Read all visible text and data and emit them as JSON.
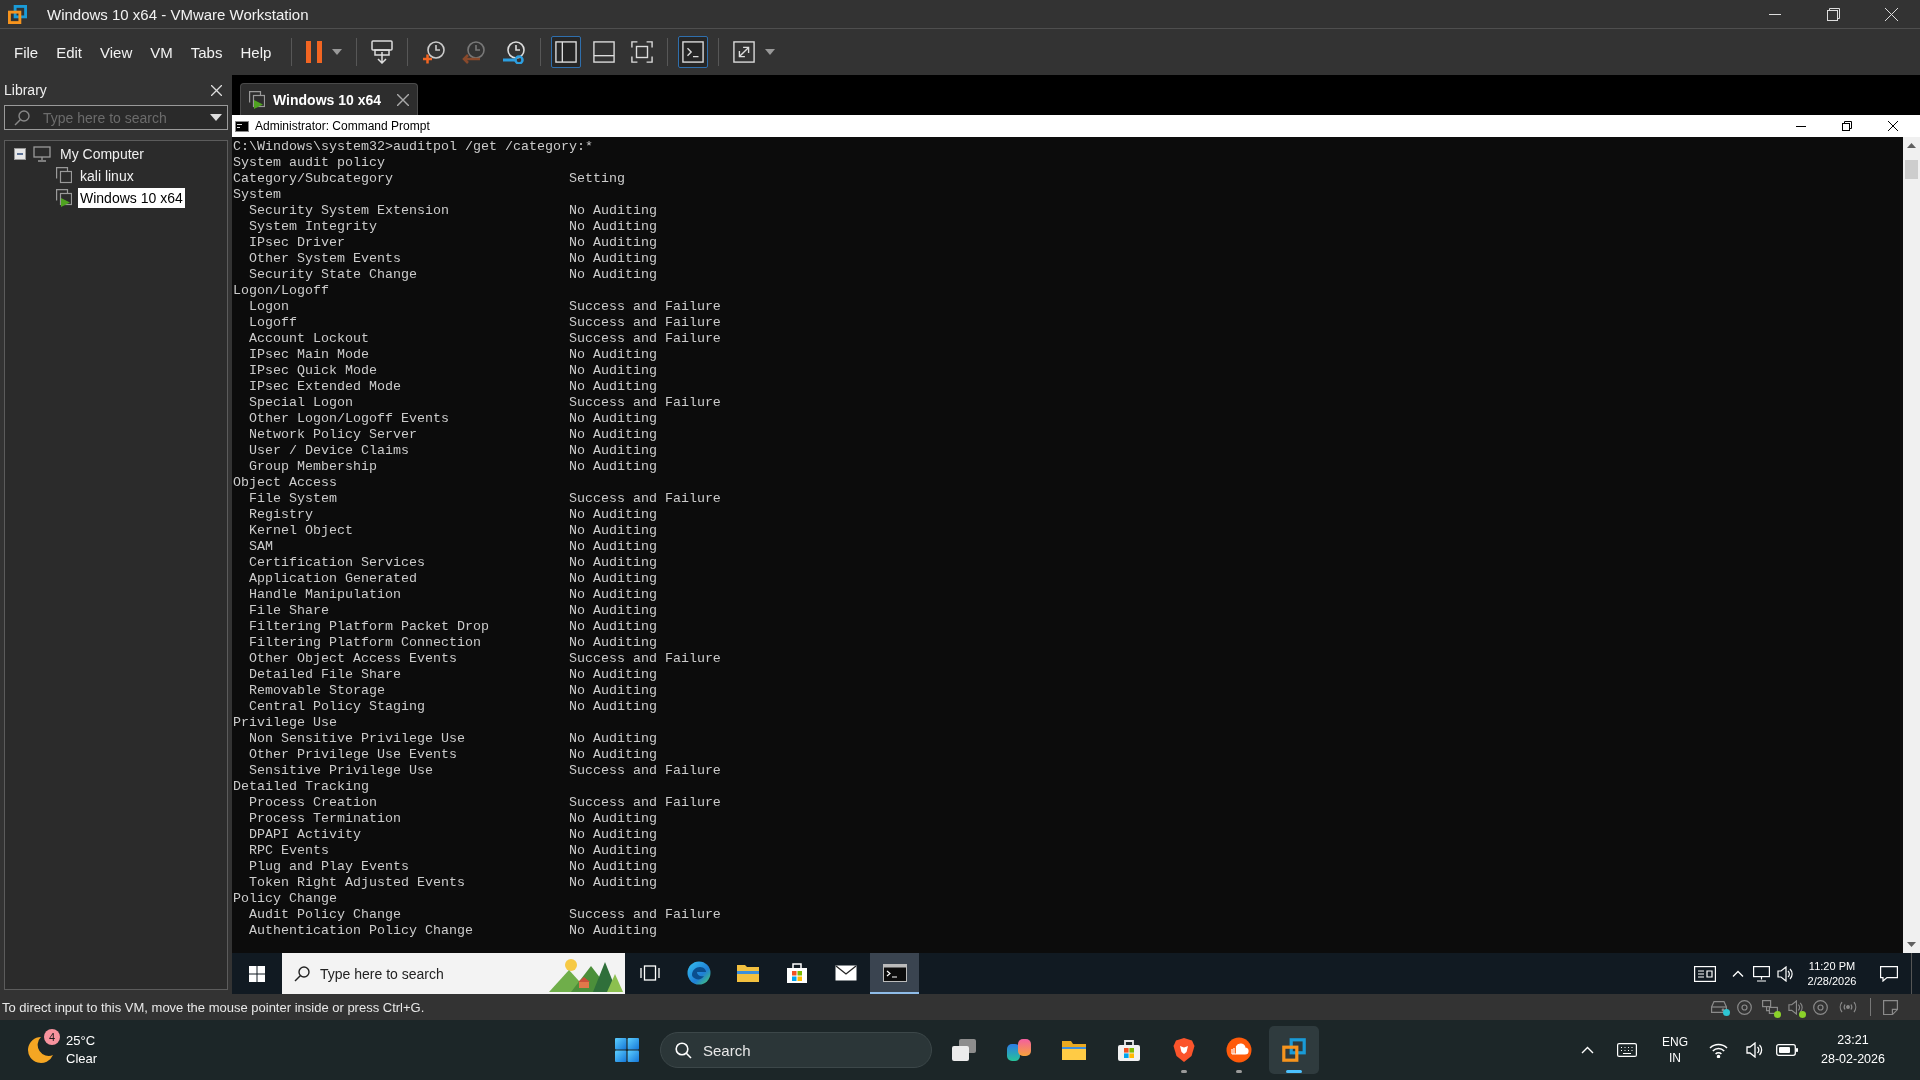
{
  "window": {
    "title": "Windows 10 x64 - VMware Workstation"
  },
  "menu": [
    "File",
    "Edit",
    "View",
    "VM",
    "Tabs",
    "Help"
  ],
  "toolbar": {
    "groups": [
      {
        "buttons": [
          {
            "kind": "pause",
            "on": false,
            "disabled": false,
            "menu": true
          }
        ]
      },
      {
        "buttons": [
          {
            "kind": "send-keys",
            "on": false,
            "disabled": false,
            "menu": false
          }
        ]
      },
      {
        "buttons": [
          {
            "kind": "snapshot",
            "on": false,
            "disabled": false,
            "menu": false
          },
          {
            "kind": "revert",
            "on": false,
            "disabled": true,
            "menu": false
          },
          {
            "kind": "snapshot-manager",
            "on": false,
            "disabled": false,
            "menu": false
          }
        ]
      },
      {
        "buttons": [
          {
            "kind": "library-view",
            "on": true,
            "disabled": false,
            "menu": false
          },
          {
            "kind": "thumbnail-bar",
            "on": false,
            "disabled": false,
            "menu": false
          },
          {
            "kind": "full-screen",
            "on": false,
            "disabled": false,
            "menu": false
          }
        ]
      },
      {
        "buttons": [
          {
            "kind": "console-view",
            "on": true,
            "disabled": false,
            "menu": false
          }
        ]
      },
      {
        "buttons": [
          {
            "kind": "stretch",
            "on": false,
            "disabled": false,
            "menu": true
          }
        ]
      }
    ]
  },
  "library": {
    "title": "Library",
    "search": {
      "placeholder": "Type here to search"
    },
    "tree": [
      {
        "label": "My Computer",
        "kind": "host",
        "expanded": true,
        "selected": false,
        "children": [
          {
            "label": "kali linux",
            "kind": "vm",
            "running": false,
            "selected": false
          },
          {
            "label": "Windows 10 x64",
            "kind": "vm",
            "running": true,
            "selected": true
          }
        ]
      }
    ]
  },
  "tabs": [
    {
      "label": "Windows 10 x64",
      "selected": true,
      "running": true
    }
  ],
  "vm_screen": {
    "console": {
      "title": "Administrator: Command Prompt",
      "command": "C:\\Windows\\system32>auditpol /get /category:*",
      "heading": "System audit policy",
      "columns": [
        "Category/Subcategory",
        "Setting"
      ],
      "categories": [
        {
          "name": "System",
          "children": [
            {
              "name": "Security System Extension",
              "setting": "No Auditing"
            },
            {
              "name": "System Integrity",
              "setting": "No Auditing"
            },
            {
              "name": "IPsec Driver",
              "setting": "No Auditing"
            },
            {
              "name": "Other System Events",
              "setting": "No Auditing"
            },
            {
              "name": "Security State Change",
              "setting": "No Auditing"
            }
          ]
        },
        {
          "name": "Logon/Logoff",
          "children": [
            {
              "name": "Logon",
              "setting": "Success and Failure"
            },
            {
              "name": "Logoff",
              "setting": "Success and Failure"
            },
            {
              "name": "Account Lockout",
              "setting": "Success and Failure"
            },
            {
              "name": "IPsec Main Mode",
              "setting": "No Auditing"
            },
            {
              "name": "IPsec Quick Mode",
              "setting": "No Auditing"
            },
            {
              "name": "IPsec Extended Mode",
              "setting": "No Auditing"
            },
            {
              "name": "Special Logon",
              "setting": "Success and Failure"
            },
            {
              "name": "Other Logon/Logoff Events",
              "setting": "No Auditing"
            },
            {
              "name": "Network Policy Server",
              "setting": "No Auditing"
            },
            {
              "name": "User / Device Claims",
              "setting": "No Auditing"
            },
            {
              "name": "Group Membership",
              "setting": "No Auditing"
            }
          ]
        },
        {
          "name": "Object Access",
          "children": [
            {
              "name": "File System",
              "setting": "Success and Failure"
            },
            {
              "name": "Registry",
              "setting": "No Auditing"
            },
            {
              "name": "Kernel Object",
              "setting": "No Auditing"
            },
            {
              "name": "SAM",
              "setting": "No Auditing"
            },
            {
              "name": "Certification Services",
              "setting": "No Auditing"
            },
            {
              "name": "Application Generated",
              "setting": "No Auditing"
            },
            {
              "name": "Handle Manipulation",
              "setting": "No Auditing"
            },
            {
              "name": "File Share",
              "setting": "No Auditing"
            },
            {
              "name": "Filtering Platform Packet Drop",
              "setting": "No Auditing"
            },
            {
              "name": "Filtering Platform Connection",
              "setting": "No Auditing"
            },
            {
              "name": "Other Object Access Events",
              "setting": "Success and Failure"
            },
            {
              "name": "Detailed File Share",
              "setting": "No Auditing"
            },
            {
              "name": "Removable Storage",
              "setting": "No Auditing"
            },
            {
              "name": "Central Policy Staging",
              "setting": "No Auditing"
            }
          ]
        },
        {
          "name": "Privilege Use",
          "children": [
            {
              "name": "Non Sensitive Privilege Use",
              "setting": "No Auditing"
            },
            {
              "name": "Other Privilege Use Events",
              "setting": "No Auditing"
            },
            {
              "name": "Sensitive Privilege Use",
              "setting": "Success and Failure"
            }
          ]
        },
        {
          "name": "Detailed Tracking",
          "children": [
            {
              "name": "Process Creation",
              "setting": "Success and Failure"
            },
            {
              "name": "Process Termination",
              "setting": "No Auditing"
            },
            {
              "name": "DPAPI Activity",
              "setting": "No Auditing"
            },
            {
              "name": "RPC Events",
              "setting": "No Auditing"
            },
            {
              "name": "Plug and Play Events",
              "setting": "No Auditing"
            },
            {
              "name": "Token Right Adjusted Events",
              "setting": "No Auditing"
            }
          ]
        },
        {
          "name": "Policy Change",
          "children": [
            {
              "name": "Audit Policy Change",
              "setting": "Success and Failure"
            },
            {
              "name": "Authentication Policy Change",
              "setting": "No Auditing"
            }
          ]
        }
      ]
    },
    "taskbar": {
      "search": {
        "placeholder": "Type here to search"
      },
      "apps": [
        {
          "kind": "task-view",
          "active": false
        },
        {
          "kind": "browser",
          "active": false
        },
        {
          "kind": "files",
          "active": false
        },
        {
          "kind": "store",
          "active": false
        },
        {
          "kind": "mail",
          "active": false
        },
        {
          "kind": "terminal",
          "active": true
        }
      ],
      "clock": {
        "time": "11:20 PM",
        "date": "2/28/2026"
      }
    }
  },
  "status_bar": {
    "message": "To direct input to this VM, move the mouse pointer inside or press Ctrl+G.",
    "devices": [
      {
        "kind": "hard-disk",
        "color": "#2ec5d3"
      },
      {
        "kind": "disc"
      },
      {
        "kind": "network",
        "color": "#8bd12a"
      },
      {
        "kind": "sound",
        "color": "#8bd12a"
      },
      {
        "kind": "disc"
      },
      {
        "kind": "wireless"
      }
    ]
  },
  "host_taskbar": {
    "weather": {
      "badge": "4",
      "temperature": "25°C",
      "condition": "Clear"
    },
    "search": {
      "placeholder": "Search"
    },
    "apps": [
      {
        "kind": "windows-stack",
        "running": false,
        "active": false
      },
      {
        "kind": "assistant",
        "running": false,
        "active": false
      },
      {
        "kind": "files",
        "running": false,
        "active": false
      },
      {
        "kind": "store",
        "running": false,
        "active": false
      },
      {
        "kind": "shield-browser",
        "running": true,
        "active": false
      },
      {
        "kind": "music",
        "running": true,
        "active": false
      },
      {
        "kind": "vm-app",
        "running": true,
        "active": true
      }
    ],
    "tray": {
      "language": "ENG",
      "region": "IN",
      "time": "23:21",
      "date": "28-02-2026"
    }
  }
}
